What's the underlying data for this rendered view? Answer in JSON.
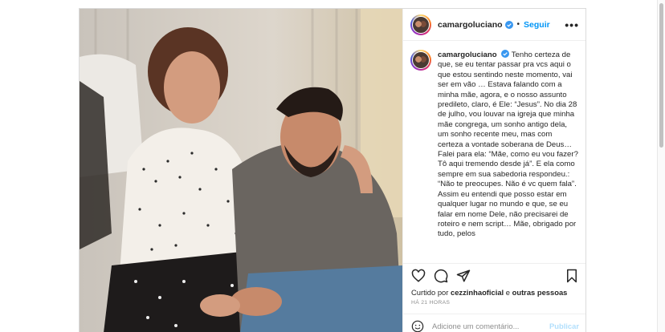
{
  "post": {
    "username": "camargoluciano",
    "follow_label": "Seguir",
    "more_label": "•••",
    "dot": "•",
    "caption_text": "Tenho certeza de que, se eu tentar passar pra vcs aqui o que estou sentindo neste momento, vai ser em vão … Estava falando com a minha mãe, agora, e o nosso assunto predileto, claro, é Ele: “Jesus”. No dia 28 de julho, vou louvar na igreja que minha mãe congrega, um sonho antigo dela, um sonho recente meu, mas com certeza a vontade soberana de Deus… Falei para ela: “Mãe, como eu vou fazer? Tô aqui tremendo desde já”. E ela como sempre em sua sabedoria respondeu.: “Não te preocupes. Não é vc quem fala”. Assim eu entendi que posso estar em qualquer lugar no mundo e que, se eu falar em nome Dele, não precisarei de roteiro e nem script… Mãe, obrigado por tudo, pelos",
    "likes_prefix": "Curtido por",
    "likes_user": "cezzinhaoficial",
    "likes_middle": "e",
    "likes_suffix": "outras pessoas",
    "timestamp": "HÁ 21 HORAS",
    "comment_placeholder": "Adicione um comentário...",
    "publish_label": "Publicar"
  },
  "icons": {
    "like": "heart-icon",
    "comment": "comment-icon",
    "share": "share-icon",
    "save": "bookmark-icon",
    "emoji": "emoji-icon",
    "verified": "verified-badge-icon"
  },
  "colors": {
    "accent": "#0095f6",
    "verified": "#3897f0",
    "muted": "#8e8e8e",
    "publish_disabled": "#b2dffc"
  }
}
